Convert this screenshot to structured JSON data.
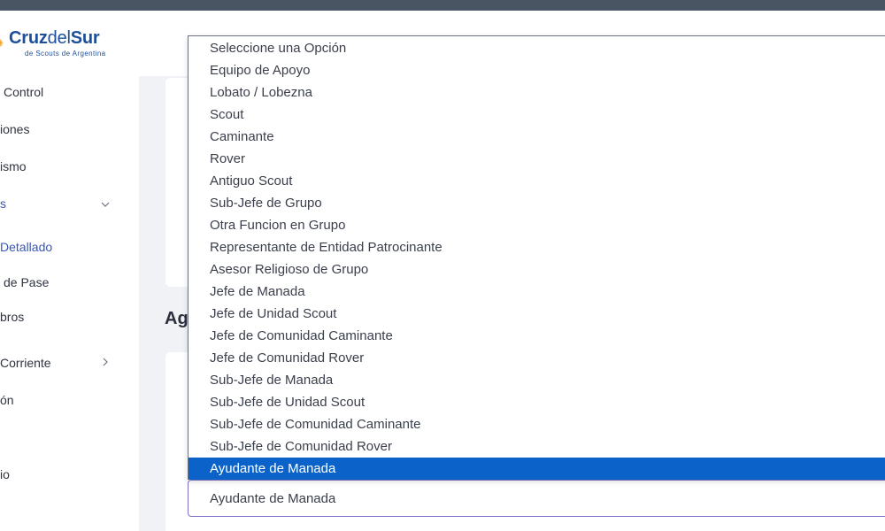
{
  "logo": {
    "brand_bold": "Cruz",
    "brand_thin": "del",
    "brand_bold2": "Sur",
    "tagline": "de Scouts de Argentina",
    "star_icon": "star-icon"
  },
  "sidebar": {
    "items": [
      {
        "label": "Control"
      },
      {
        "label": "iones"
      },
      {
        "label": "ismo"
      },
      {
        "label": "s"
      },
      {
        "label": "Detallado"
      },
      {
        "label": "de Pase"
      },
      {
        "label": "bros"
      },
      {
        "label": "Corriente"
      },
      {
        "label": "ón"
      },
      {
        "label": "io"
      }
    ]
  },
  "main": {
    "section_title": "Ag"
  },
  "select": {
    "value": "Ayudante de Manada",
    "options": [
      "Seleccione una Opción",
      "Equipo de Apoyo",
      "Lobato / Lobezna",
      "Scout",
      "Caminante",
      "Rover",
      "Antiguo Scout",
      "Sub-Jefe de Grupo",
      "Otra Funcion en Grupo",
      "Representante de Entidad Patrocinante",
      "Asesor Religioso de Grupo",
      "Jefe de Manada",
      "Jefe de Unidad Scout",
      "Jefe de Comunidad Caminante",
      "Jefe de Comunidad Rover",
      "Sub-Jefe de Manada",
      "Sub-Jefe de Unidad Scout",
      "Sub-Jefe de Comunidad Caminante",
      "Sub-Jefe de Comunidad Rover",
      "Ayudante de Manada"
    ],
    "highlighted_index": 19
  },
  "colors": {
    "accent": "#3757b8",
    "highlight": "#0b63c9",
    "brand": "#1d4f9c",
    "topbar": "#4a5563"
  }
}
